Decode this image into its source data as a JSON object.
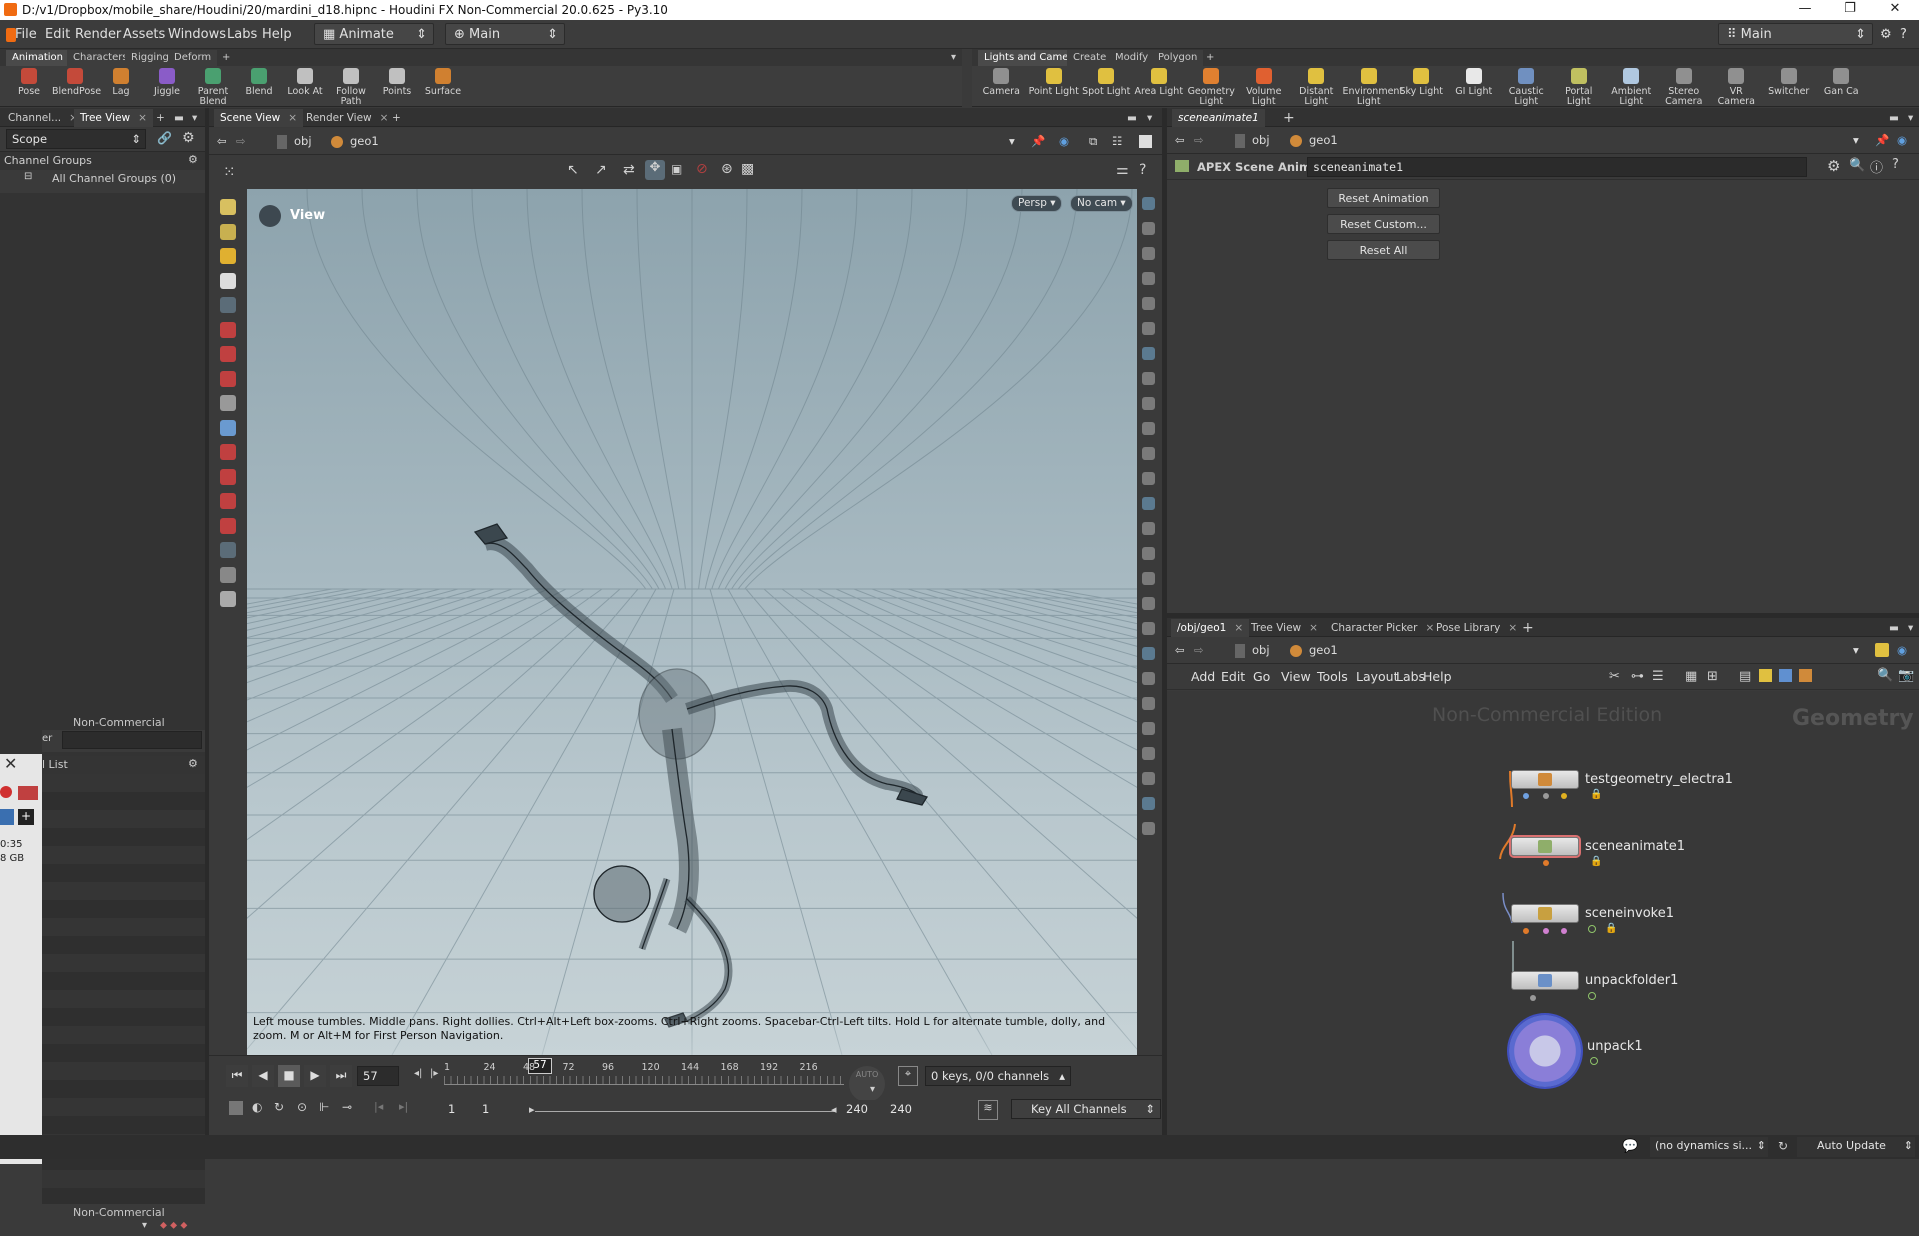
{
  "window": {
    "title": "D:/v1/Dropbox/mobile_share/Houdini/20/mardini_d18.hipnc - Houdini FX Non-Commercial 20.0.625 - Py3.10",
    "minimize": "—",
    "maximize": "❐",
    "close": "✕"
  },
  "menu": {
    "items": [
      "File",
      "Edit",
      "Render",
      "Assets",
      "Windows",
      "Labs",
      "Help"
    ],
    "desktop_left": "Animate",
    "desktop_main": "Main",
    "desktop_right": "Main"
  },
  "shelf_left": {
    "tabs": [
      "Animation",
      "Characters",
      "Rigging",
      "Deform"
    ],
    "tools": [
      {
        "label": "Pose",
        "color": "#c44a3a"
      },
      {
        "label": "BlendPose",
        "color": "#c44a3a"
      },
      {
        "label": "Lag",
        "color": "#d08030"
      },
      {
        "label": "Jiggle",
        "color": "#8a5cc8"
      },
      {
        "label": "Parent Blend",
        "color": "#4aa070"
      },
      {
        "label": "Blend",
        "color": "#4aa070"
      },
      {
        "label": "Look At",
        "color": "#c0c0c0"
      },
      {
        "label": "Follow Path",
        "color": "#c0c0c0"
      },
      {
        "label": "Points",
        "color": "#c0c0c0"
      },
      {
        "label": "Surface",
        "color": "#d08030"
      }
    ]
  },
  "shelf_right": {
    "tabs": [
      "Lights and Cameras",
      "Create",
      "Modify",
      "Polygon"
    ],
    "tools": [
      {
        "label": "Camera",
        "color": "#909090"
      },
      {
        "label": "Point Light",
        "color": "#e0c040"
      },
      {
        "label": "Spot Light",
        "color": "#e0c040"
      },
      {
        "label": "Area Light",
        "color": "#e0c040"
      },
      {
        "label": "Geometry Light",
        "color": "#e08030"
      },
      {
        "label": "Volume Light",
        "color": "#e06030"
      },
      {
        "label": "Distant Light",
        "color": "#e0c040"
      },
      {
        "label": "Environment Light",
        "color": "#e0c040"
      },
      {
        "label": "Sky Light",
        "color": "#e0c040"
      },
      {
        "label": "GI Light",
        "color": "#e8e8e8"
      },
      {
        "label": "Caustic Light",
        "color": "#7090c0"
      },
      {
        "label": "Portal Light",
        "color": "#c0c060"
      },
      {
        "label": "Ambient Light",
        "color": "#b0c8e0"
      },
      {
        "label": "Stereo Camera",
        "color": "#909090"
      },
      {
        "label": "VR Camera",
        "color": "#909090"
      },
      {
        "label": "Switcher",
        "color": "#909090"
      },
      {
        "label": "Gan Ca",
        "color": "#909090"
      }
    ]
  },
  "left_pane": {
    "tabs": [
      "Channel...",
      "Tree View"
    ],
    "scope": "Scope",
    "channel_groups_header": "Channel Groups",
    "all_channel_groups": "All Channel Groups (0)",
    "watermark_top": "Non-Commercial Edition",
    "list_header": "l List",
    "watermark_bottom": "Non-Commercial Edition",
    "side_frag_time": "0:35",
    "side_frag_mem": "8 GB",
    "side_frag_er": "er"
  },
  "viewer": {
    "tabs": [
      "Scene View",
      "Render View"
    ],
    "path": [
      "obj",
      "geo1"
    ],
    "view_label": "View",
    "persp": "Persp ▾",
    "nocam": "No cam ▾",
    "hint": "Left mouse tumbles. Middle pans. Right dollies. Ctrl+Alt+Left box-zooms. Ctrl+Right zooms. Spacebar-Ctrl-Left tilts. Hold L for alternate tumble, dolly, and zoom. M or Alt+M for First Person Navigation."
  },
  "parm_pane": {
    "tab": "sceneanimate1",
    "path": [
      "obj",
      "geo1"
    ],
    "node_type": "APEX Scene Animate",
    "node_name": "sceneanimate1",
    "buttons": [
      "Reset Animation",
      "Reset Custom...",
      "Reset All"
    ]
  },
  "network_pane": {
    "tabs": [
      "/obj/geo1",
      "Tree View",
      "Character Picker",
      "Pose Library"
    ],
    "path": [
      "obj",
      "geo1"
    ],
    "menu": [
      "Add",
      "Edit",
      "Go",
      "View",
      "Tools",
      "Layout",
      "Labs",
      "Help"
    ],
    "watermark": "Non-Commercial Edition",
    "context": "Geometry",
    "nodes": [
      "testgeometry_electra1",
      "sceneanimate1",
      "sceneinvoke1",
      "unpackfolder1",
      "unpack1"
    ]
  },
  "playbar": {
    "frame": "57",
    "current_marker": "57",
    "ticks": [
      "1",
      "24",
      "48",
      "72",
      "96",
      "120",
      "144",
      "168",
      "192",
      "216"
    ],
    "start": "1",
    "start2": "1",
    "end": "240",
    "end2": "240",
    "keys_info": "0 keys, 0/0 channels",
    "key_all": "Key All Channels",
    "auto": "AUTO"
  },
  "status": {
    "dynamics": "(no dynamics si...",
    "auto_update": "Auto Update"
  },
  "colors": {
    "accent_orange": "#f06b12",
    "node_wire": "#e07a2a",
    "selected_outline": "#d97070",
    "panel_bg": "#3a3a3a"
  }
}
